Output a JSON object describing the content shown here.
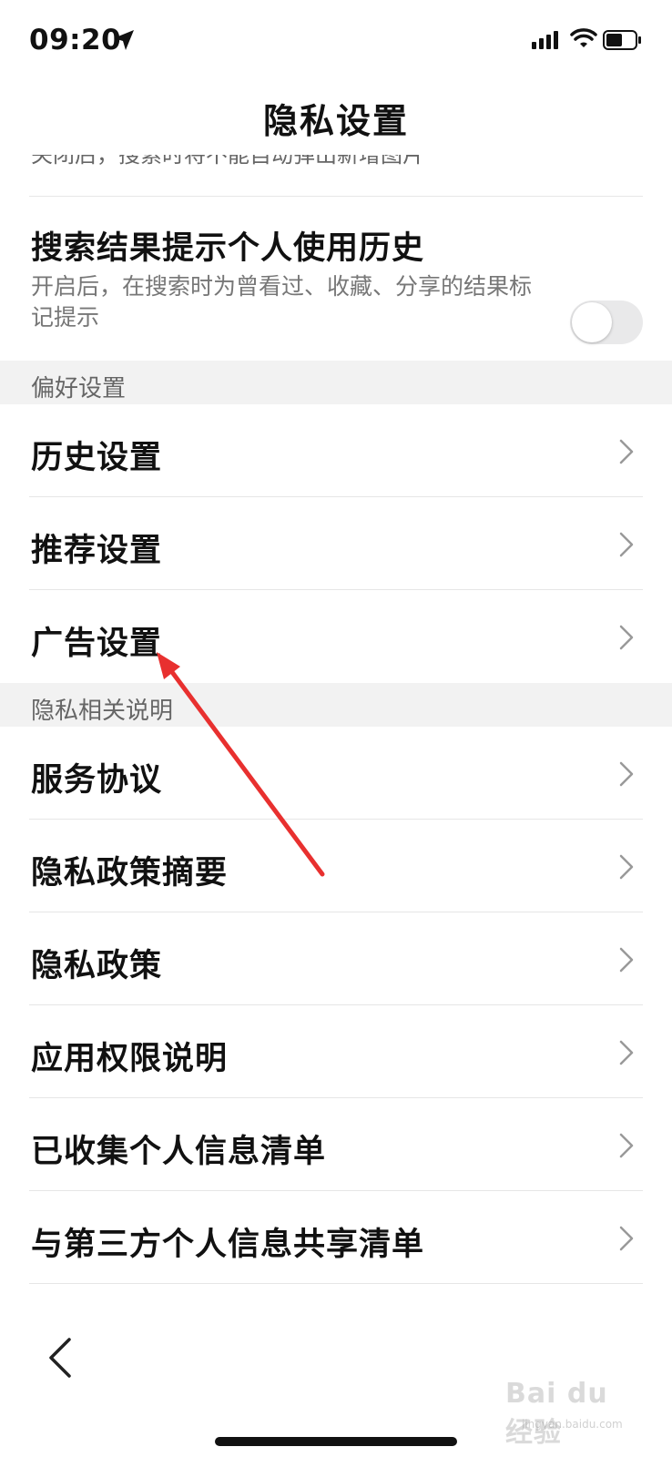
{
  "status_bar": {
    "time": "09:20"
  },
  "header": {
    "title": "隐私设置"
  },
  "cut_off_text": "关闭后，搜索时将不能自动弹出新增图片",
  "toggle_setting": {
    "title": "搜索结果提示个人使用历史",
    "description": "开启后，在搜索时为曾看过、收藏、分享的结果标记提示",
    "enabled": false
  },
  "sections": [
    {
      "header": "偏好设置",
      "items": [
        "历史设置",
        "推荐设置",
        "广告设置"
      ]
    },
    {
      "header": "隐私相关说明",
      "items": [
        "服务协议",
        "隐私政策摘要",
        "隐私政策",
        "应用权限说明",
        "已收集个人信息清单",
        "与第三方个人信息共享清单"
      ]
    }
  ],
  "watermark": {
    "text": "Bai du 经验",
    "sub": "jingyan.baidu.com"
  },
  "colors": {
    "annotation": "#e8302f",
    "toggle_off": "#e9e9ea",
    "section_bg": "#f2f2f2"
  }
}
